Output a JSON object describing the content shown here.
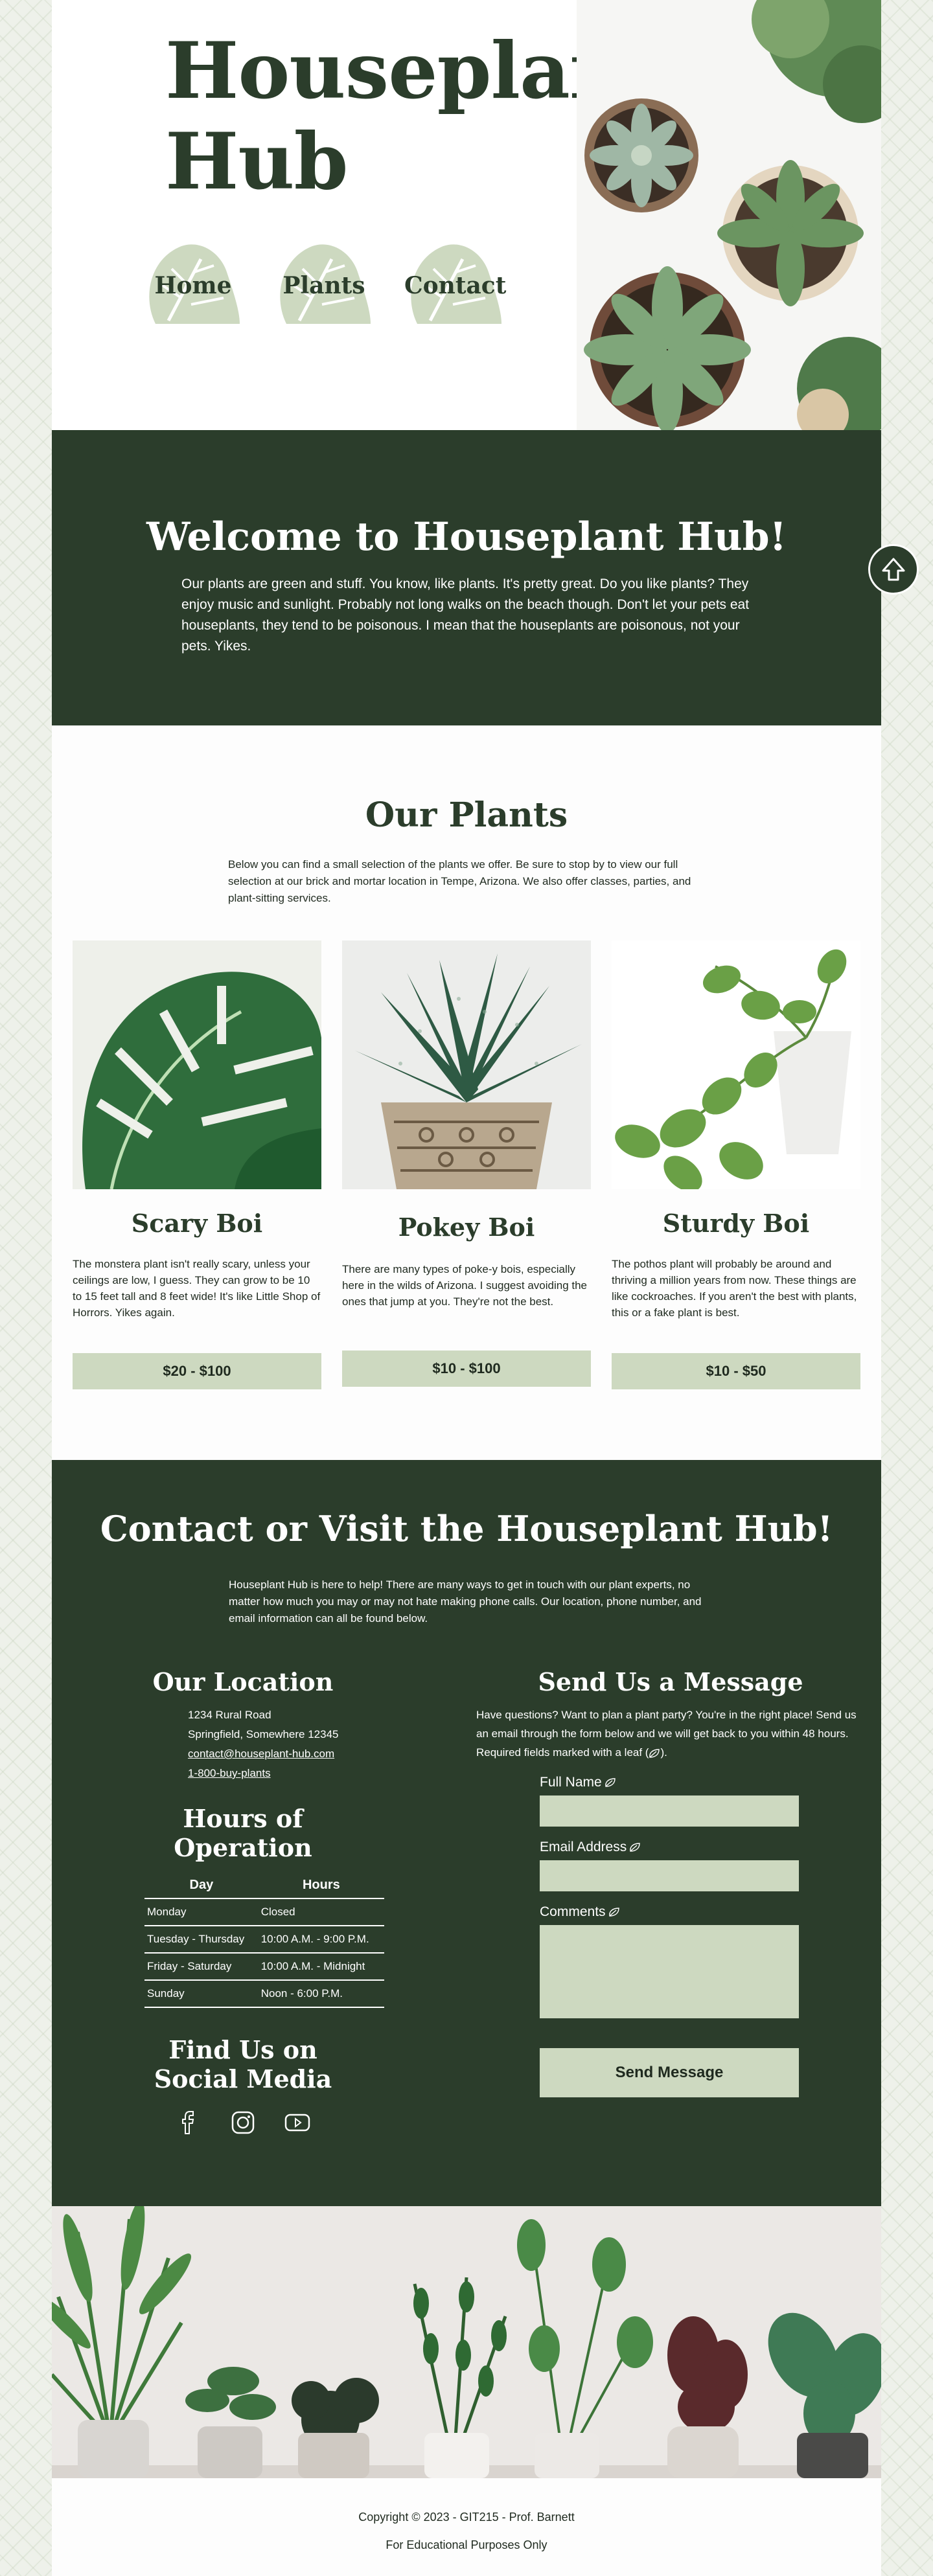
{
  "site": {
    "title": "Houseplant Hub"
  },
  "nav": {
    "items": [
      {
        "label": "Home"
      },
      {
        "label": "Plants"
      },
      {
        "label": "Contact"
      }
    ]
  },
  "welcome": {
    "heading": "Welcome to Houseplant Hub!",
    "text": "Our plants are green and stuff. You know, like plants. It's pretty great. Do you like plants? They enjoy music and sunlight. Probably not long walks on the beach though. Don't let your pets eat houseplants, they tend to be poisonous. I mean that the houseplants are poisonous, not your pets. Yikes."
  },
  "plants": {
    "heading": "Our Plants",
    "intro": "Below you can find a small selection of the plants we offer. Be sure to stop by to view our full selection at our brick and mortar location in Tempe, Arizona. We also offer classes, parties, and plant-sitting services.",
    "cards": [
      {
        "name": "Scary Boi",
        "description": "The monstera plant isn't really scary, unless your ceilings are low, I guess. They can grow to be 10 to 15 feet tall and 8 feet wide! It's like Little Shop of Horrors. Yikes again.",
        "price": "$20 - $100"
      },
      {
        "name": "Pokey Boi",
        "description": "There are many types of poke-y bois, especially here in the wilds of Arizona. I suggest avoiding the ones that jump at you. They're not the best.",
        "price": "$10 - $100"
      },
      {
        "name": "Sturdy Boi",
        "description": "The pothos plant will probably be around and thriving a million years from now. These things are like cockroaches. If you aren't the best with plants, this or a fake plant is best.",
        "price": "$10 - $50"
      }
    ]
  },
  "contact": {
    "heading": "Contact or Visit the Houseplant Hub!",
    "intro": "Houseplant Hub is here to help! There are many ways to get in touch with our plant experts, no matter how much you may or may not hate making phone calls. Our location, phone number, and email information can all be found below.",
    "location": {
      "heading": "Our Location",
      "street": "1234 Rural Road",
      "city": "Springfield, Somewhere 12345",
      "email": "contact@houseplant-hub.com",
      "phone": "1-800-buy-plants"
    },
    "hours": {
      "heading": "Hours of Operation",
      "columns": [
        "Day",
        "Hours"
      ],
      "rows": [
        [
          "Monday",
          "Closed"
        ],
        [
          "Tuesday - Thursday",
          "10:00 A.M. - 9:00 P.M."
        ],
        [
          "Friday - Saturday",
          "10:00 A.M. - Midnight"
        ],
        [
          "Sunday",
          "Noon - 6:00 P.M."
        ]
      ]
    },
    "social": {
      "heading": "Find Us on Social Media",
      "icons": [
        "facebook-icon",
        "instagram-icon",
        "youtube-icon"
      ]
    },
    "message": {
      "heading": "Send Us a Message",
      "intro_before": "Have questions? Want to plan a plant party? You're in the right place! Send us an email through the form below and we will get back to you within 48 hours. Required fields marked with a leaf (",
      "intro_after": ").",
      "fields": {
        "name": "Full Name",
        "email": "Email Address",
        "comments": "Comments"
      },
      "submit": "Send Message"
    }
  },
  "footer": {
    "copyright": "Copyright © 2023 - GIT215 - Prof. Barnett",
    "note": "For Educational Purposes Only"
  },
  "colors": {
    "dark_green": "#2b3d2b",
    "sage": "#cdd9c0",
    "white": "#ffffff"
  }
}
